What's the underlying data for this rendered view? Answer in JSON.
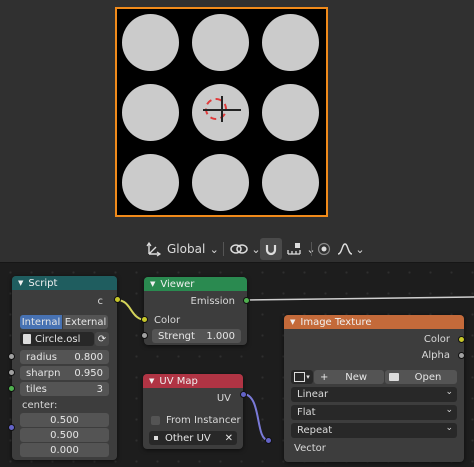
{
  "toolbar": {
    "orientation_label": "Global"
  },
  "script_node": {
    "title": "Script",
    "output_c": "c",
    "mode_internal": "Internal",
    "mode_external": "External",
    "script_name": "Circle.osl",
    "inputs": [
      {
        "label": "radius",
        "value": "0.800"
      },
      {
        "label": "sharpn",
        "value": "0.950"
      },
      {
        "label": "tiles",
        "value": "3"
      }
    ],
    "center_label": "center:",
    "center": [
      "0.500",
      "0.500",
      "0.000"
    ]
  },
  "viewer_node": {
    "title": "Viewer",
    "output": "Emission",
    "input_color": "Color",
    "strength_label": "Strengt",
    "strength_value": "1.000"
  },
  "image_texture_node": {
    "title": "Image Texture",
    "out_color": "Color",
    "out_alpha": "Alpha",
    "new_label": "New",
    "open_label": "Open",
    "interpolation": "Linear",
    "projection": "Flat",
    "extension": "Repeat",
    "input_vector": "Vector"
  },
  "uv_map_node": {
    "title": "UV Map",
    "output": "UV",
    "from_instancer": "From Instancer",
    "uv_name": "Other UV"
  },
  "colors": {
    "script_header": "#1f5d5f",
    "viewer_header": "#2a8a50",
    "uv_header": "#b03444",
    "texture_header": "#c46a3a",
    "selection_border": "#f08a1a"
  }
}
